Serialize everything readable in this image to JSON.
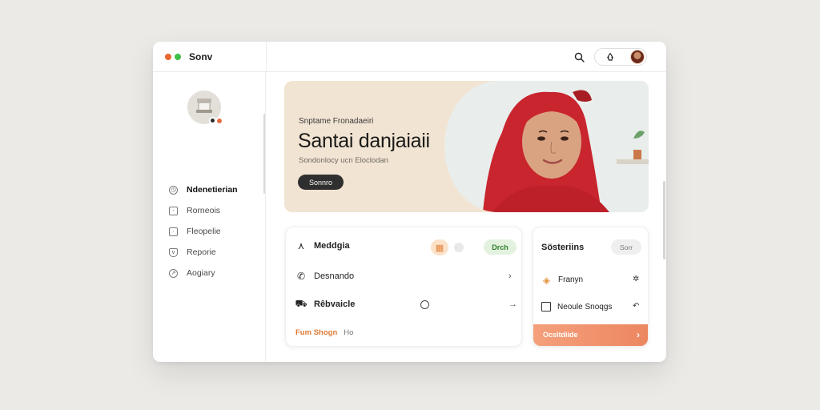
{
  "window": {
    "title": "Sonv",
    "traffic_colors": [
      "#e8672f",
      "#3fbf4b"
    ]
  },
  "header": {
    "search_icon": "search-icon",
    "pill_icon": "recycle-icon",
    "avatar": "user-avatar"
  },
  "sidebar": {
    "items": [
      {
        "label": "Ndenetierian",
        "icon": "clock-icon",
        "active": true
      },
      {
        "label": "Rorneois",
        "icon": "box-icon",
        "active": false
      },
      {
        "label": "Fleopelie",
        "icon": "box-icon",
        "active": false
      },
      {
        "label": "Reporie",
        "icon": "shield-icon",
        "active": false
      },
      {
        "label": "Aogiary",
        "icon": "compass-icon",
        "active": false
      }
    ]
  },
  "hero": {
    "eyebrow": "Snptame Fronadaeiri",
    "title": "Santai danjaiaii",
    "subtitle": "Sondonlocy ucn Eloclodan",
    "button": "Sonnro"
  },
  "actions": {
    "rows": [
      {
        "label": "Meddgia",
        "icon": "fork-icon"
      },
      {
        "label": "Desnando",
        "icon": "phone-icon"
      },
      {
        "label": "Rêbvaicle",
        "icon": "car-icon"
      }
    ],
    "badge": "Drch",
    "footer_link": "Fum Shogn",
    "footer_num": "Ho"
  },
  "side_card": {
    "title": "Sösteriins",
    "button": "Sorr",
    "rows": [
      {
        "label": "Franyn",
        "icon": "tag-icon"
      },
      {
        "label": "Neoule Snoqgs",
        "icon": "checkbox-icon"
      }
    ],
    "footer": "Ocsitdiide"
  }
}
